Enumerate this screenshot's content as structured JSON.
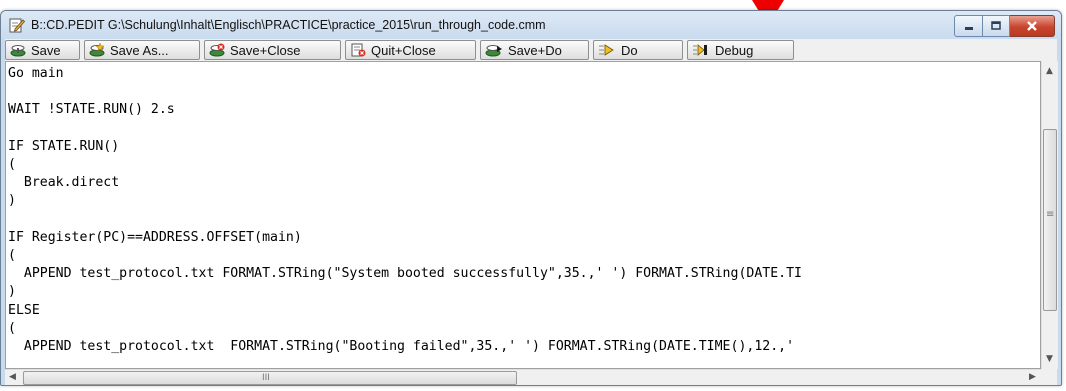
{
  "window": {
    "title": "B::CD.PEDIT G:\\Schulung\\Inhalt\\Englisch\\PRACTICE\\practice_2015\\run_through_code.cmm"
  },
  "toolbar": {
    "buttons": [
      {
        "label": "Save",
        "icon": "save-icon"
      },
      {
        "label": "Save As...",
        "icon": "save-as-icon"
      },
      {
        "label": "Save+Close",
        "icon": "save-close-icon"
      },
      {
        "label": "Quit+Close",
        "icon": "quit-close-icon"
      },
      {
        "label": "Save+Do",
        "icon": "save-do-icon"
      },
      {
        "label": "Do",
        "icon": "do-icon"
      },
      {
        "label": "Debug",
        "icon": "debug-icon"
      }
    ]
  },
  "editor": {
    "lines": [
      "Go main",
      "",
      "WAIT !STATE.RUN() 2.s",
      "",
      "IF STATE.RUN()",
      "(",
      "  Break.direct",
      ")",
      "",
      "IF Register(PC)==ADDRESS.OFFSET(main)",
      "(",
      "  APPEND test_protocol.txt FORMAT.STRing(\"System booted successfully\",35.,' ') FORMAT.STRing(DATE.TI",
      ")",
      "ELSE",
      "(",
      "  APPEND test_protocol.txt  FORMAT.STRing(\"Booting failed\",35.,' ') FORMAT.STRing(DATE.TIME(),12.,'"
    ]
  },
  "scrollbars": {
    "horizontal_grip": "III",
    "vertical_grip": "≡"
  },
  "colors": {
    "indicator_arrow": "#ee0000",
    "titlebar": "#c9dbee",
    "close_button": "#c8452e"
  }
}
